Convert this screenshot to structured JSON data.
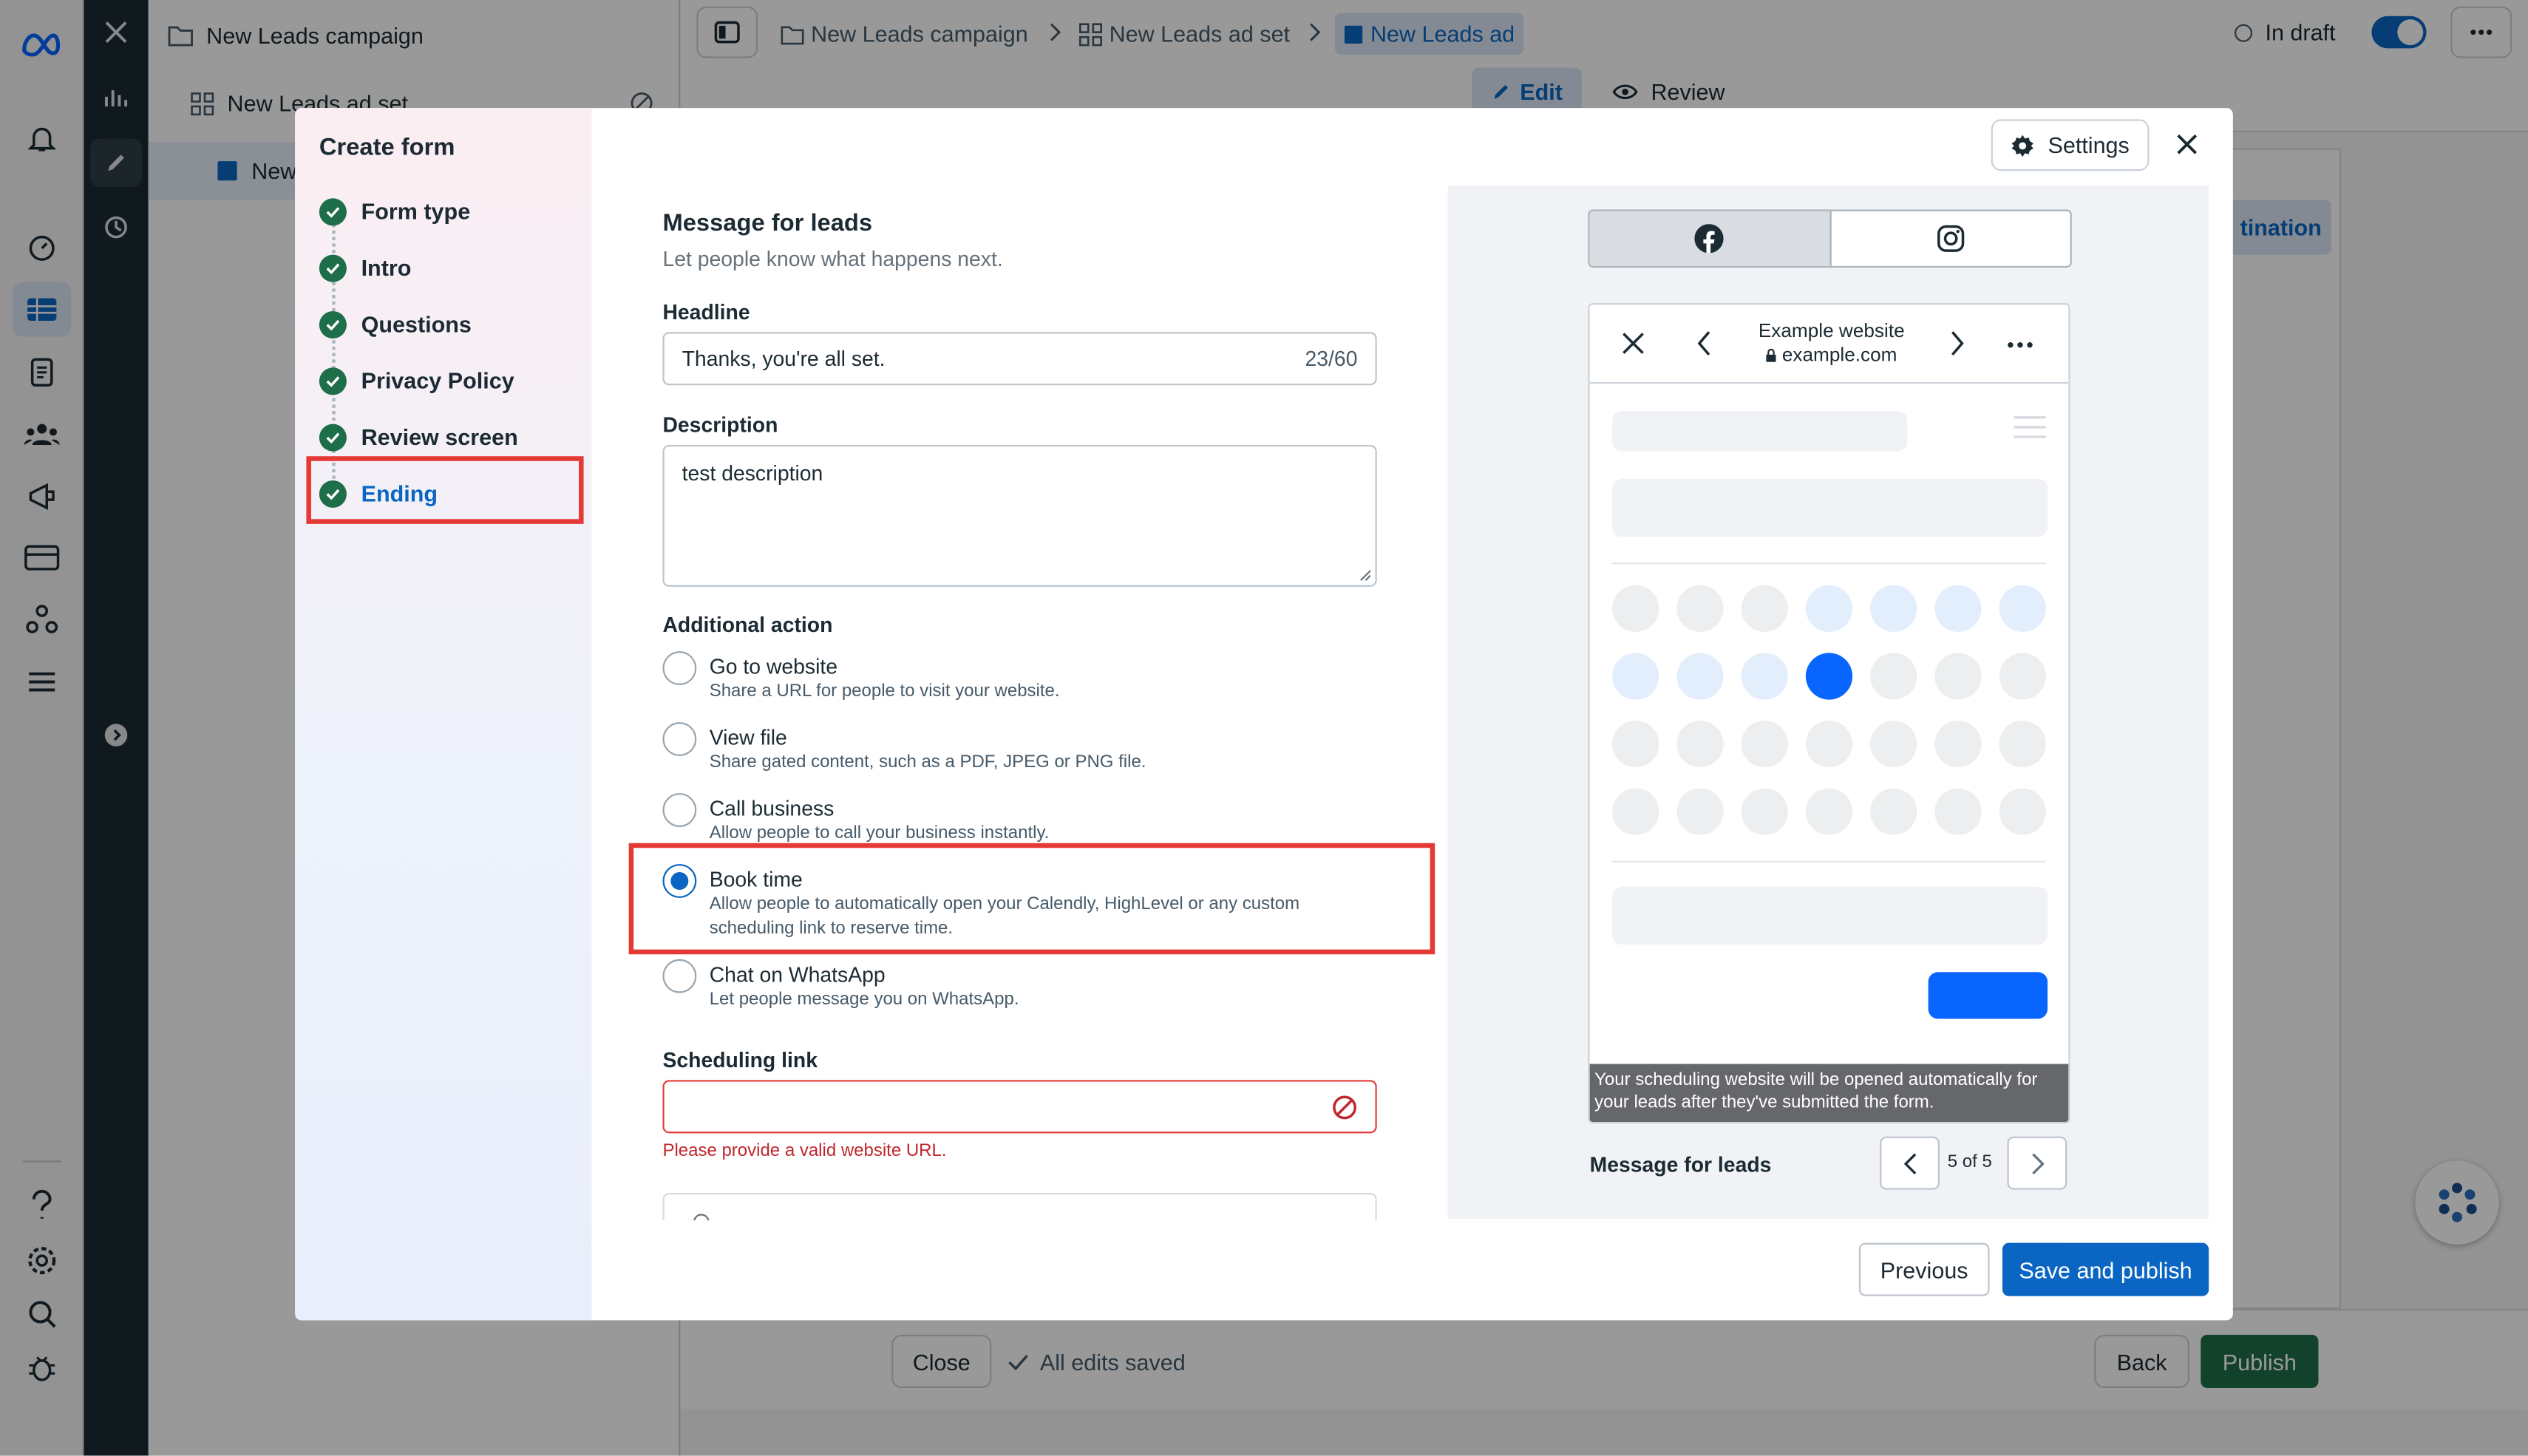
{
  "breadcrumb": {
    "campaign": "New Leads campaign",
    "adset": "New Leads ad set",
    "ad": "New Leads ad"
  },
  "tree": {
    "campaign": "New Leads campaign",
    "adset": "New Leads ad set",
    "ad": "New"
  },
  "topbar": {
    "status": "In draft",
    "edit": "Edit",
    "review": "Review",
    "destination": "tination"
  },
  "bottombar": {
    "close": "Close",
    "saved": "All edits saved",
    "back": "Back",
    "publish": "Publish"
  },
  "modal": {
    "title": "Create form",
    "steps": [
      {
        "label": "Form type"
      },
      {
        "label": "Intro"
      },
      {
        "label": "Questions"
      },
      {
        "label": "Privacy Policy"
      },
      {
        "label": "Review screen"
      },
      {
        "label": "Ending"
      }
    ],
    "settings": "Settings",
    "section_title": "Message for leads",
    "section_sub": "Let people know what happens next.",
    "headline_label": "Headline",
    "headline_value": "Thanks, you're all set.",
    "headline_count": "23/60",
    "description_label": "Description",
    "description_value": "test description",
    "additional_label": "Additional action",
    "options": [
      {
        "title": "Go to website",
        "desc": "Share a URL for people to visit your website."
      },
      {
        "title": "View file",
        "desc": "Share gated content, such as a PDF, JPEG or PNG file."
      },
      {
        "title": "Call business",
        "desc": "Allow people to call your business instantly."
      },
      {
        "title": "Book time",
        "desc": "Allow people to automatically open your Calendly, HighLevel or any custom scheduling link to reserve time."
      },
      {
        "title": "Chat on WhatsApp",
        "desc": "Let people message you on WhatsApp."
      }
    ],
    "selected_option": "Book time",
    "scheduling_label": "Scheduling link",
    "scheduling_value": "",
    "scheduling_error": "Please provide a valid website URL.",
    "previous": "Previous",
    "save_publish": "Save and publish"
  },
  "preview": {
    "site_title": "Example website",
    "site_url": "example.com",
    "caption": "Your scheduling website will be opened automatically for your leads after they've submitted the form.",
    "footer_label": "Message for leads",
    "pager": "5 of 5"
  },
  "colors": {
    "accent": "#0a66c2",
    "error": "#e53935",
    "check": "#1e6e4a",
    "preview_blue": "#0866ff"
  }
}
